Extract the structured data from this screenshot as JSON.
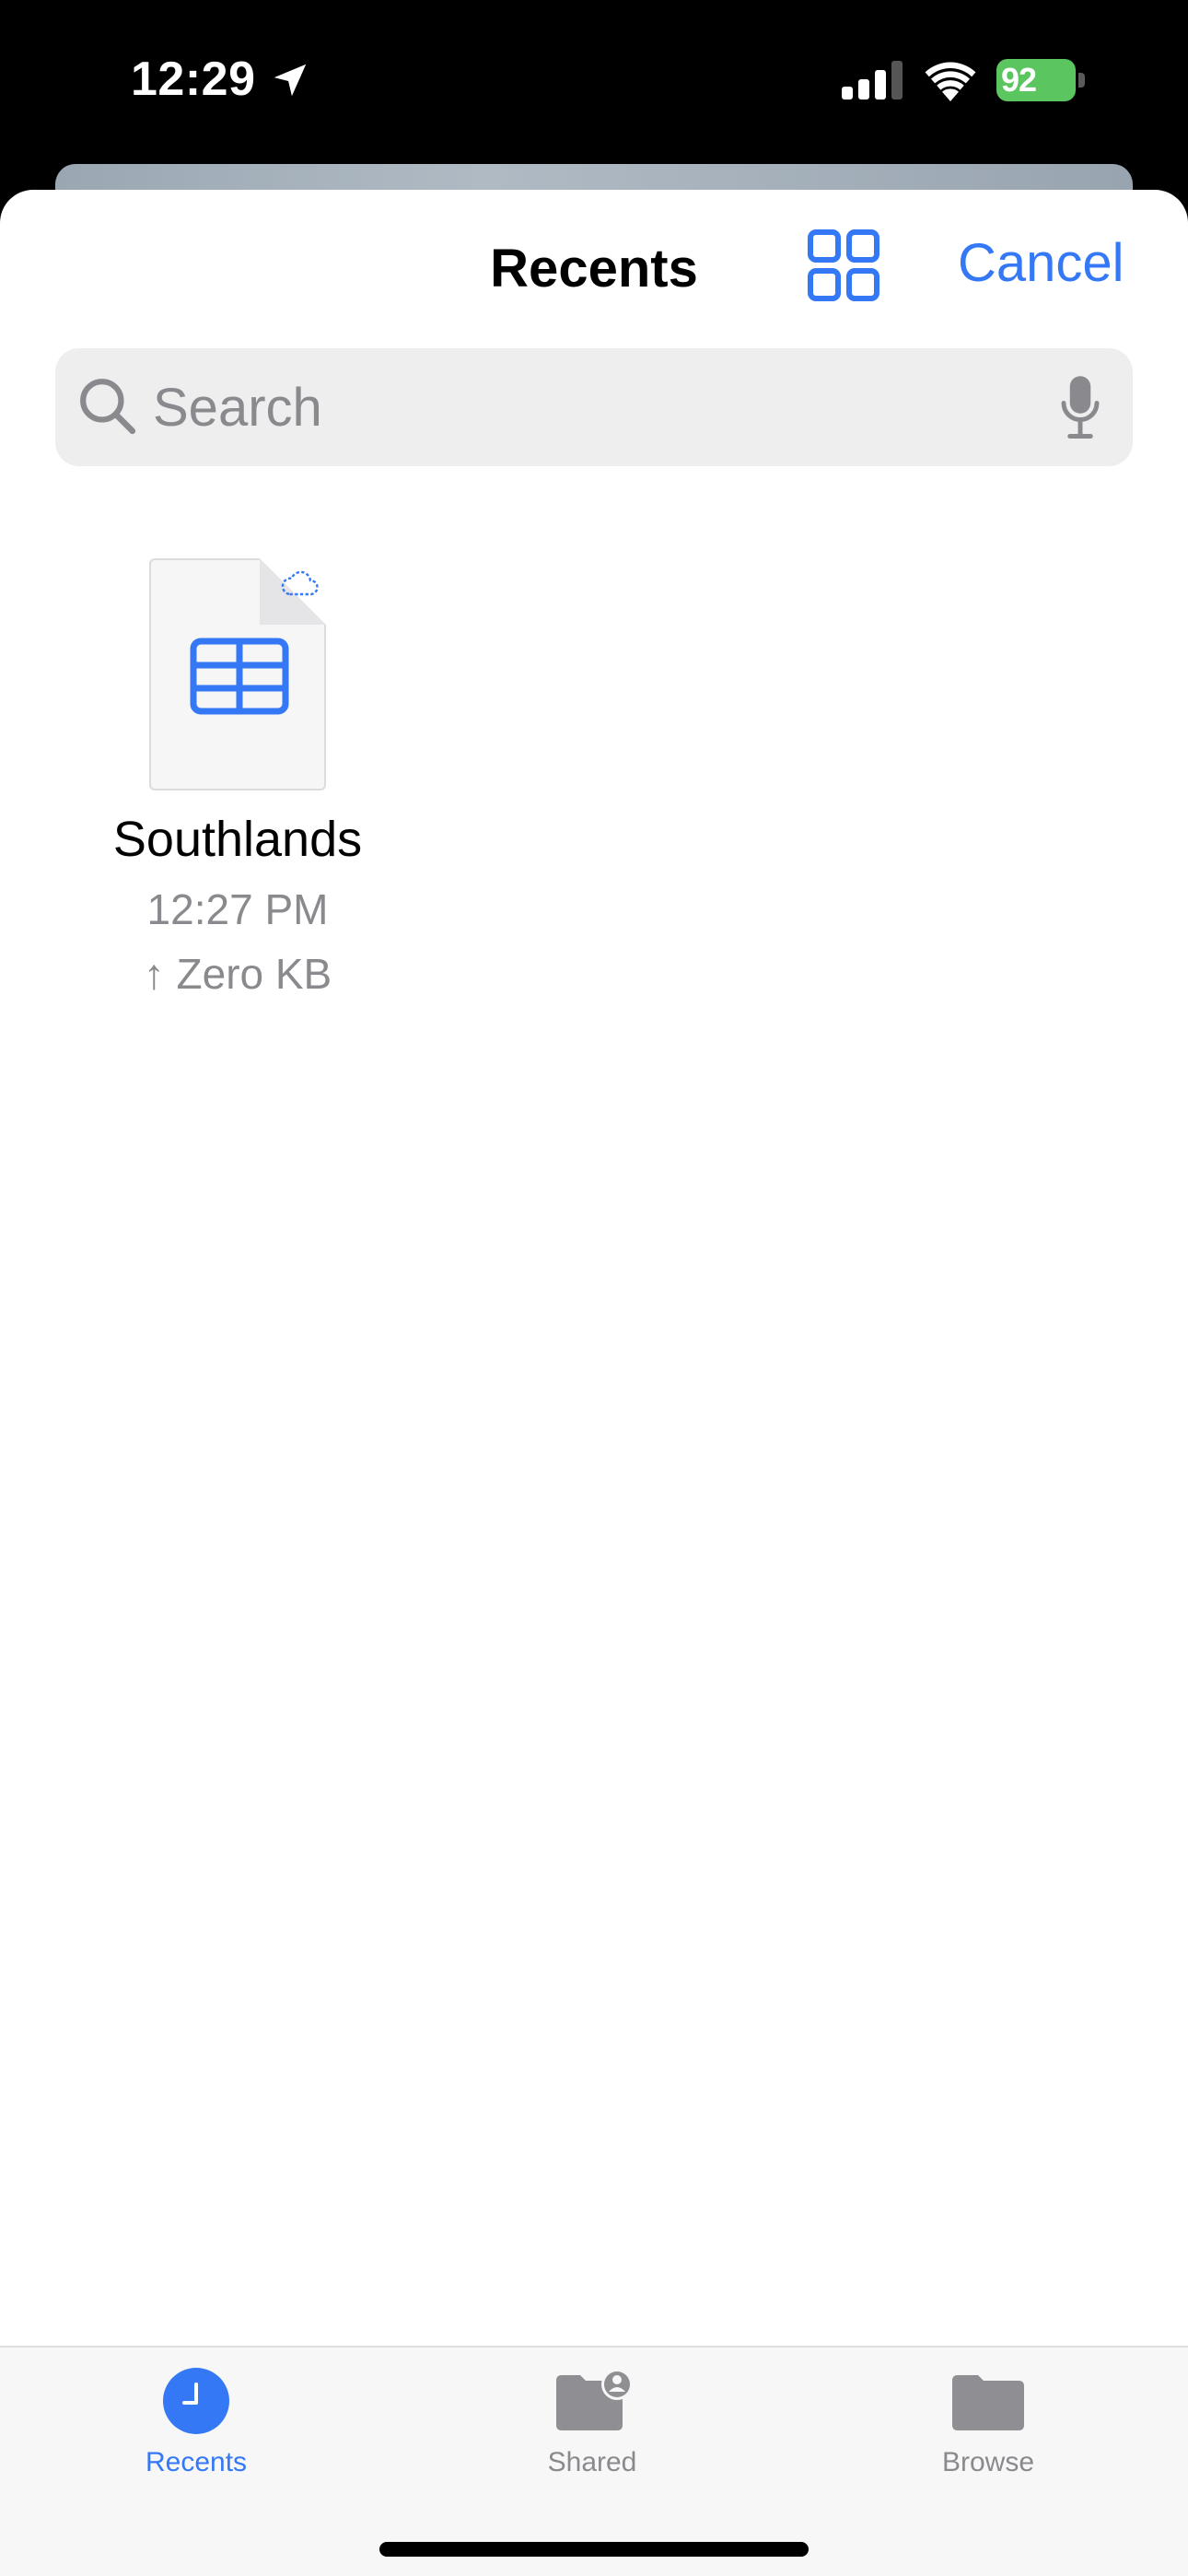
{
  "status_bar": {
    "time": "12:29",
    "battery": "92",
    "icons": [
      "location-arrow-icon",
      "cellular-signal-icon",
      "wifi-icon",
      "battery-charging-icon"
    ]
  },
  "header": {
    "title": "Recents",
    "grid_icon": "grid-view-icon",
    "cancel_label": "Cancel"
  },
  "search": {
    "placeholder": "Search",
    "value": ""
  },
  "files": [
    {
      "name": "Southlands",
      "time": "12:27 PM",
      "size": "Zero KB",
      "upload_arrow": "↑",
      "icon": "spreadsheet-table-icon",
      "cloud_icon": "icloud-uploading-icon"
    }
  ],
  "tabs": [
    {
      "label": "Recents",
      "icon": "clock-icon",
      "active": true
    },
    {
      "label": "Shared",
      "icon": "shared-folder-icon",
      "active": false
    },
    {
      "label": "Browse",
      "icon": "folder-icon",
      "active": false
    }
  ],
  "colors": {
    "accent": "#3478f6",
    "battery": "#5bc55f",
    "secondary_text": "#8a8a8e",
    "search_bg": "#eeeeef"
  }
}
